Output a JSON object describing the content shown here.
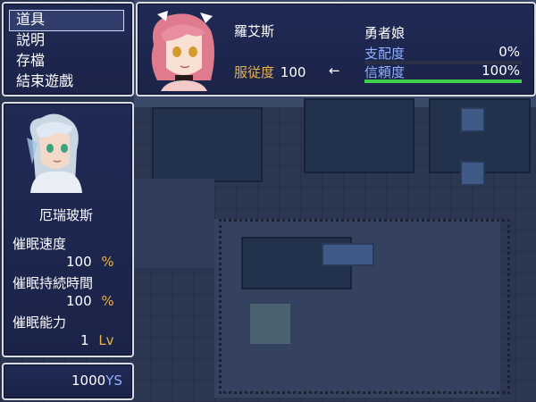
{
  "menu": {
    "items": [
      {
        "label": "道具"
      },
      {
        "label": "説明"
      },
      {
        "label": "存檔"
      },
      {
        "label": "結束遊戲"
      }
    ],
    "selected_index": 0
  },
  "player": {
    "name": "厄瑞玻斯",
    "stats": [
      {
        "label": "催眠速度",
        "value": "100",
        "unit": "%"
      },
      {
        "label": "催眠持続時間",
        "value": "100",
        "unit": "%"
      },
      {
        "label": "催眠能力",
        "value": "1",
        "unit": "Lv"
      }
    ]
  },
  "gold": {
    "value": "1000",
    "unit": "YS"
  },
  "target": {
    "name": "羅艾斯",
    "obedience_label": "服従度",
    "obedience_value": "100",
    "arrow": "←",
    "class_name": "勇者娘",
    "domination": {
      "label": "支配度",
      "value": "0%",
      "fill": 0
    },
    "trust": {
      "label": "信頼度",
      "value": "100%",
      "fill": 1.0
    }
  },
  "colors": {
    "window_bg": "#1f2a55",
    "window_border": "#d9dbe5",
    "accent_text": "#e8b24a",
    "gauge_fill": "#3fd24f",
    "stat_label_blue": "#8fb0ff"
  }
}
